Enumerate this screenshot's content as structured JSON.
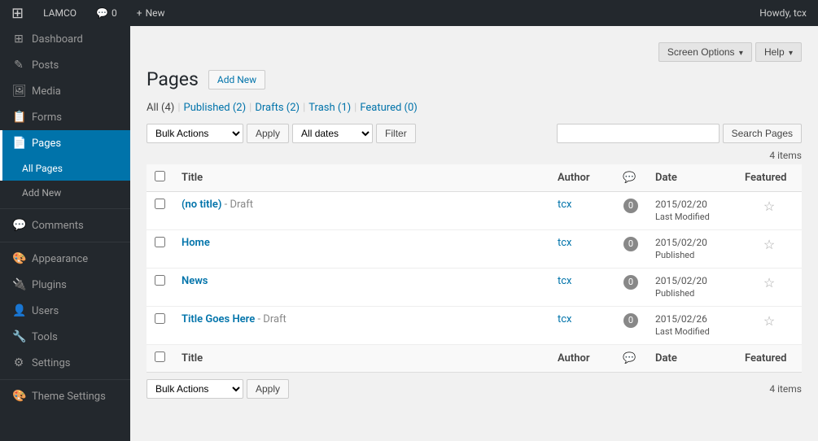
{
  "adminbar": {
    "site_name": "LAMCO",
    "comments_count": "0",
    "new_label": "New",
    "howdy": "Howdy, tcx"
  },
  "sidebar": {
    "items": [
      {
        "id": "dashboard",
        "label": "Dashboard",
        "icon": "⊞"
      },
      {
        "id": "posts",
        "label": "Posts",
        "icon": "✎"
      },
      {
        "id": "media",
        "label": "Media",
        "icon": "🖼"
      },
      {
        "id": "forms",
        "label": "Forms",
        "icon": "📋"
      },
      {
        "id": "pages",
        "label": "Pages",
        "icon": "📄",
        "active": true
      },
      {
        "id": "all-pages",
        "label": "All Pages",
        "sub": true,
        "active": true
      },
      {
        "id": "add-new",
        "label": "Add New",
        "sub": true
      },
      {
        "id": "comments",
        "label": "Comments",
        "icon": "💬"
      },
      {
        "id": "appearance",
        "label": "Appearance",
        "icon": "🎨"
      },
      {
        "id": "plugins",
        "label": "Plugins",
        "icon": "🔌"
      },
      {
        "id": "users",
        "label": "Users",
        "icon": "👤"
      },
      {
        "id": "tools",
        "label": "Tools",
        "icon": "🔧"
      },
      {
        "id": "settings",
        "label": "Settings",
        "icon": "⚙"
      },
      {
        "id": "theme-settings",
        "label": "Theme Settings",
        "icon": "🎨"
      }
    ]
  },
  "header": {
    "title": "Pages",
    "add_new": "Add New",
    "screen_options": "Screen Options",
    "help": "Help"
  },
  "filter_tabs": [
    {
      "id": "all",
      "label": "All",
      "count": "(4)",
      "active": true
    },
    {
      "id": "published",
      "label": "Published",
      "count": "(2)"
    },
    {
      "id": "drafts",
      "label": "Drafts",
      "count": "(2)"
    },
    {
      "id": "trash",
      "label": "Trash",
      "count": "(1)"
    },
    {
      "id": "featured",
      "label": "Featured",
      "count": "(0)"
    }
  ],
  "toolbar": {
    "bulk_actions_top": "Bulk Actions",
    "apply_top": "Apply",
    "bulk_actions_bottom": "Bulk Actions",
    "apply_bottom": "Apply",
    "date_filter": "All dates",
    "filter_btn": "Filter",
    "search_input_placeholder": "",
    "search_btn": "Search Pages",
    "items_count_top": "4 items",
    "items_count_bottom": "4 items"
  },
  "table": {
    "columns": [
      "Title",
      "Author",
      "",
      "Date",
      "Featured"
    ],
    "rows": [
      {
        "id": 1,
        "title": "(no title)",
        "status": "Draft",
        "author": "tcx",
        "comments": "0",
        "date": "2015/02/20",
        "date_status": "Last Modified",
        "featured": false
      },
      {
        "id": 2,
        "title": "Home",
        "status": "",
        "author": "tcx",
        "comments": "0",
        "date": "2015/02/20",
        "date_status": "Published",
        "featured": false
      },
      {
        "id": 3,
        "title": "News",
        "status": "",
        "author": "tcx",
        "comments": "0",
        "date": "2015/02/20",
        "date_status": "Published",
        "featured": false
      },
      {
        "id": 4,
        "title": "Title Goes Here",
        "status": "Draft",
        "author": "tcx",
        "comments": "0",
        "date": "2015/02/26",
        "date_status": "Last Modified",
        "featured": false
      }
    ]
  }
}
